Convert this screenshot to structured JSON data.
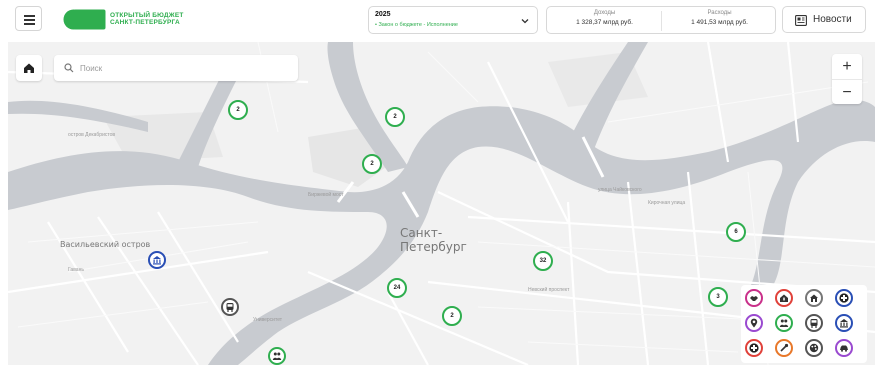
{
  "header": {
    "logo_line1": "ОТКРЫТЫЙ БЮДЖЕТ",
    "logo_line2": "САНКТ-ПЕТЕРБУРГА",
    "year": "2025",
    "status": "• Закон о бюджете - Исполнение",
    "income_label": "Доходы",
    "income_value": "1 328,37 млрд руб.",
    "expense_label": "Расходы",
    "expense_value": "1 491,53 млрд руб.",
    "news_label": "Новости"
  },
  "map": {
    "search_placeholder": "Поиск",
    "zoom_in": "+",
    "zoom_out": "−",
    "city_label": "Санкт-\nПетербург",
    "district_label": "Васильевский остров",
    "small_labels": [
      "остров Декабристов",
      "Гавань",
      "улица Чайковского",
      "Кирочная улица",
      "Биржевой мост",
      "Университет",
      "Невский проспект"
    ],
    "clusters": [
      "2",
      "2",
      "2",
      "6",
      "32",
      "24",
      "2",
      "3"
    ],
    "accent_color": "#2fae4f"
  },
  "legend": {
    "icons": [
      "handshake-icon",
      "house-fire-icon",
      "house-icon",
      "medical-cross-icon",
      "location-pin-icon",
      "people-icon",
      "bus-icon",
      "bank-icon",
      "medical-cross-icon",
      "tools-icon",
      "palette-icon",
      "car-icon"
    ]
  }
}
